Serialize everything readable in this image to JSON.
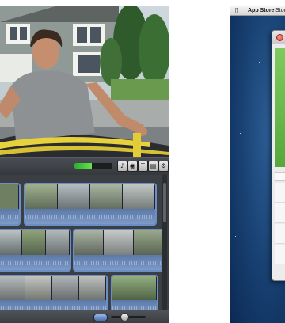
{
  "imovie": {
    "audio_meter_level": 0.45,
    "toolbar_buttons": [
      "voiceover-icon",
      "camera-icon",
      "title-icon",
      "transition-icon",
      "effects-icon"
    ],
    "toolbar_glyphs": [
      "♪",
      "◉",
      "T",
      "▤",
      "⚙"
    ]
  },
  "desktop": {
    "menubar": {
      "apple_glyph": "",
      "app_name": "App Store",
      "next_menu": "Store"
    }
  },
  "colors": {
    "imovie_bg": "#2d3034",
    "clip_border": "#6b8fc4",
    "app_banner": "#6fbf4f",
    "close_button": "#d4392d",
    "desktop_bg": "#173f70"
  }
}
